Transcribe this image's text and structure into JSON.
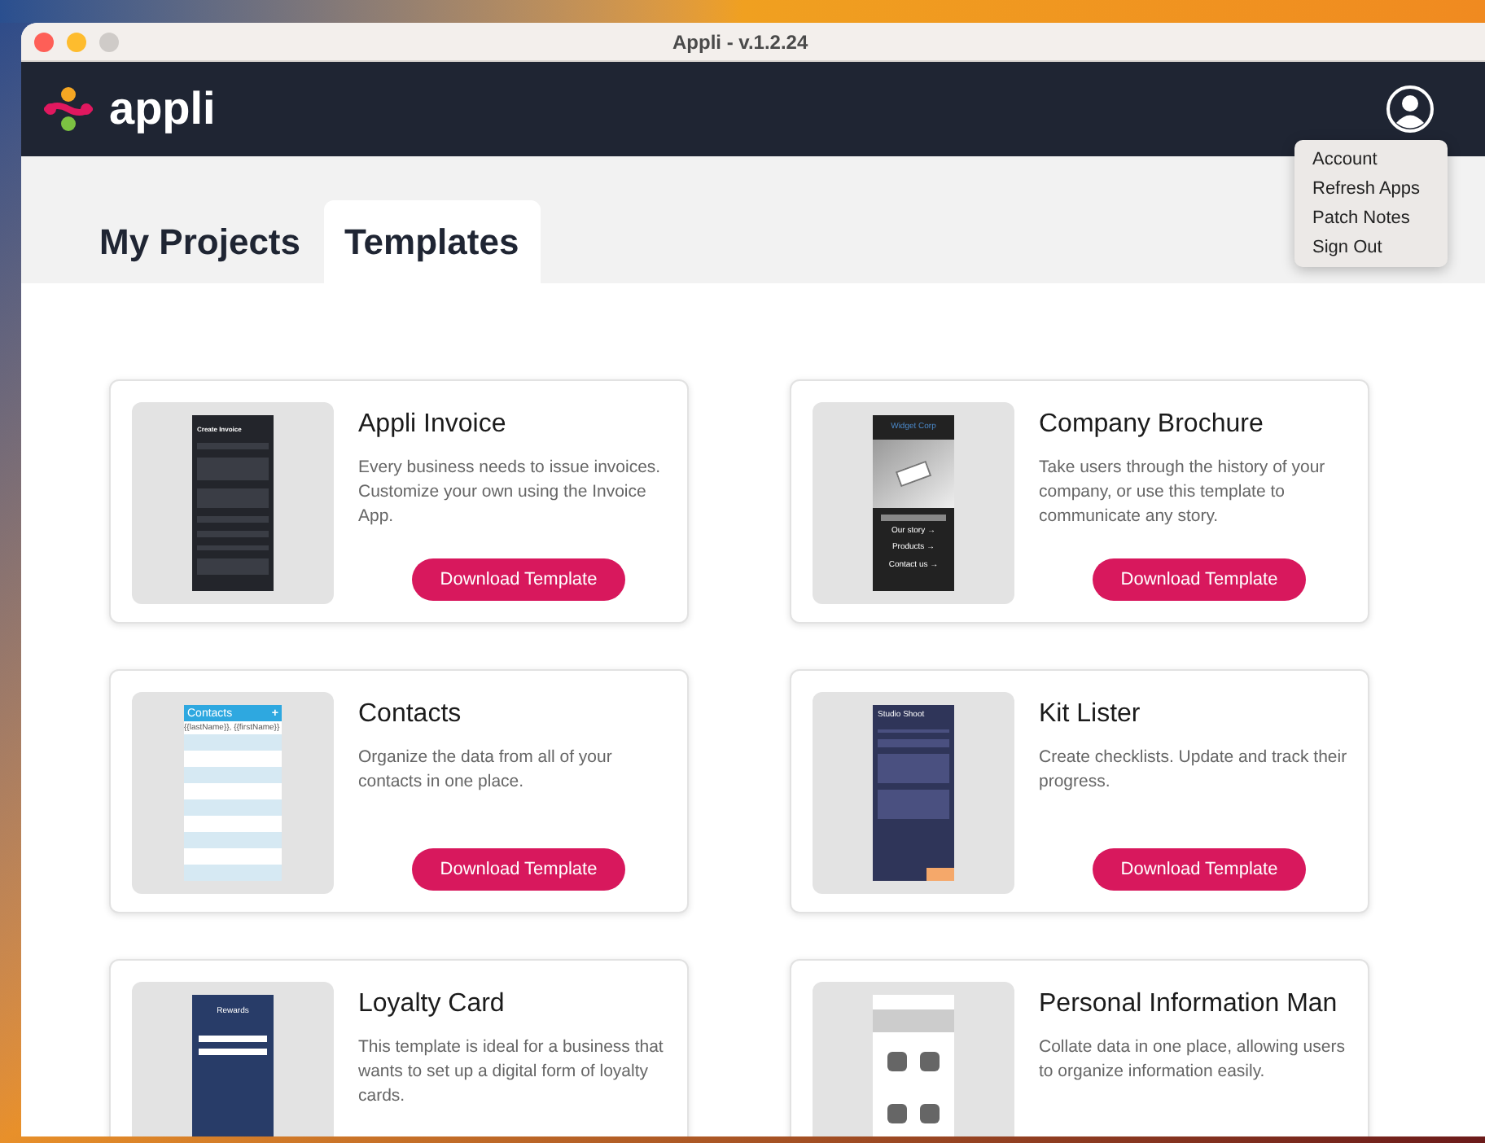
{
  "window": {
    "title": "Appli - v.1.2.24"
  },
  "header": {
    "logo_text": "appli"
  },
  "account_menu": {
    "items": [
      {
        "label": "Account"
      },
      {
        "label": "Refresh Apps"
      },
      {
        "label": "Patch Notes"
      },
      {
        "label": "Sign Out"
      }
    ]
  },
  "tabs": [
    {
      "label": "My Projects",
      "selected": false
    },
    {
      "label": "Templates",
      "selected": true
    }
  ],
  "templates": [
    {
      "title": "Appli Invoice",
      "description": "Every business needs to issue invoices. Customize your own using the Invoice App.",
      "button": "Download Template",
      "preview": {
        "kind": "invoice",
        "texts": [
          "Create Invoice"
        ]
      }
    },
    {
      "title": "Company Brochure",
      "description": "Take users through the history of your company, or use this template to communicate any story.",
      "button": "Download Template",
      "preview": {
        "kind": "brochure",
        "texts": [
          "Widget Corp",
          "Our story →",
          "Products →",
          "Contact us →"
        ]
      }
    },
    {
      "title": "Contacts",
      "description": "Organize the data from all of your contacts in one place.",
      "button": "Download Template",
      "preview": {
        "kind": "contacts",
        "texts": [
          "Contacts",
          "+",
          "{{lastName}}, {{firstName}}"
        ]
      }
    },
    {
      "title": "Kit Lister",
      "description": "Create checklists. Update and track their progress.",
      "button": "Download Template",
      "preview": {
        "kind": "checklist",
        "texts": [
          "Studio Shoot"
        ]
      }
    },
    {
      "title": "Loyalty Card",
      "description": "This template is ideal for a business that wants to set up a digital form of loyalty cards.",
      "preview": {
        "kind": "rewards",
        "texts": [
          "Rewards"
        ]
      }
    },
    {
      "title": "Personal Information Man",
      "description": "Collate data in one place, allowing users to organize information easily.",
      "preview": {
        "kind": "pim"
      }
    }
  ]
}
